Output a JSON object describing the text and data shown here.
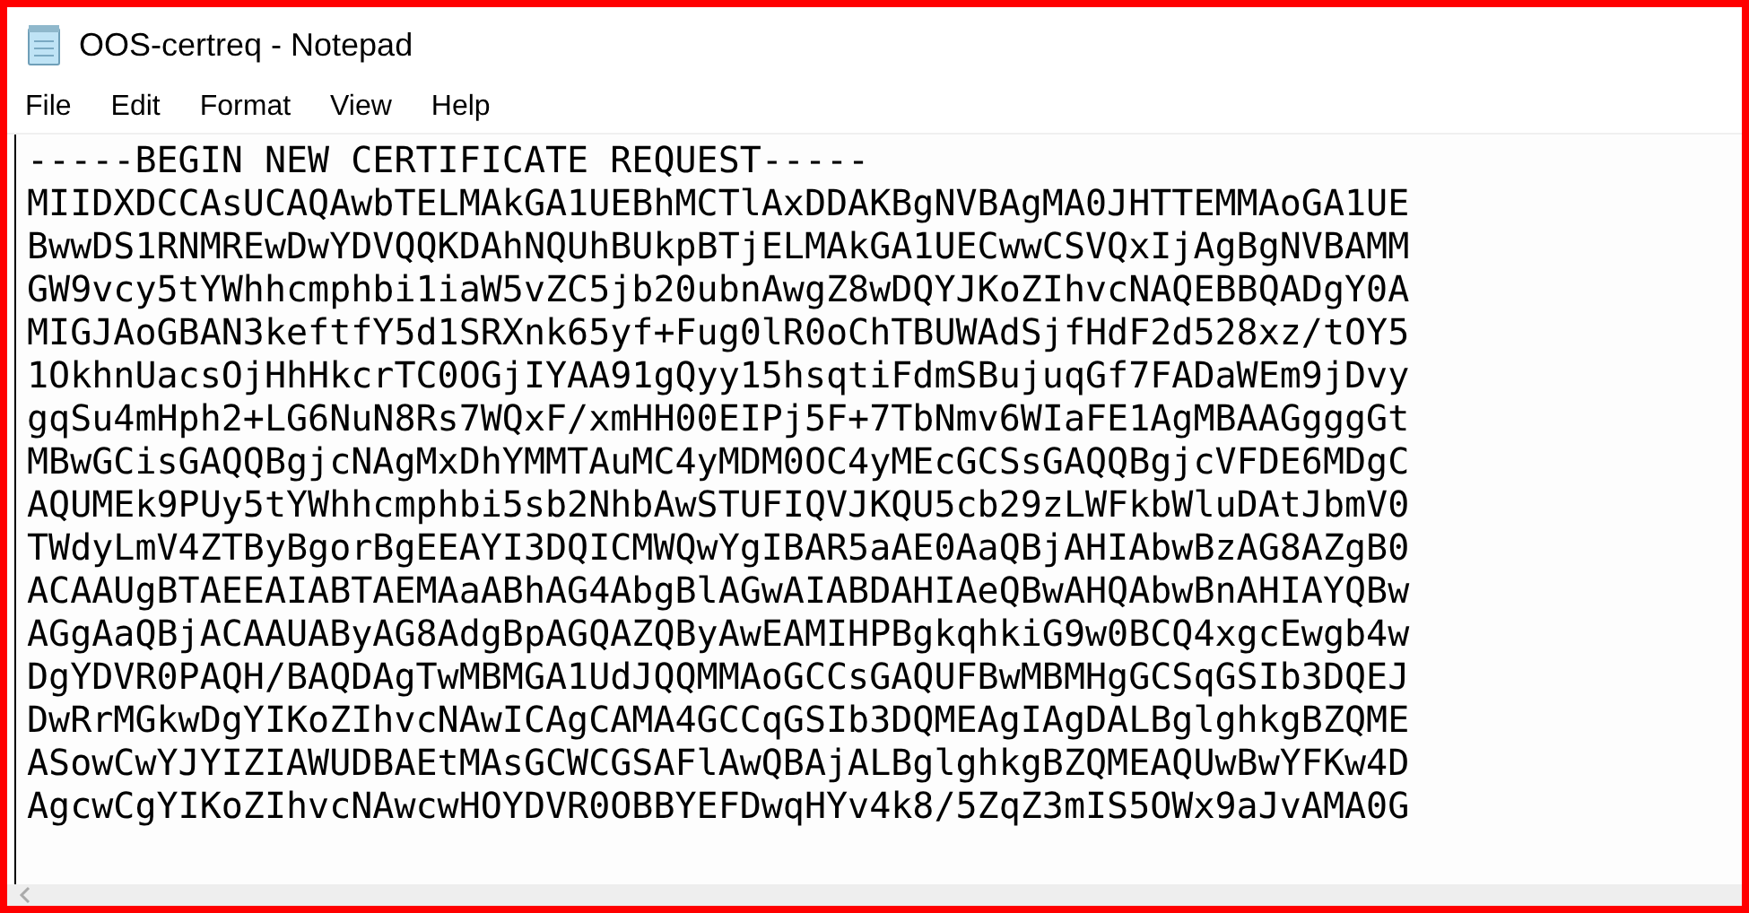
{
  "window": {
    "title": "OOS-certreq - Notepad"
  },
  "menu": [
    "File",
    "Edit",
    "Format",
    "View",
    "Help"
  ],
  "document": {
    "lines": [
      "-----BEGIN NEW CERTIFICATE REQUEST-----",
      "MIIDXDCCAsUCAQAwbTELMAkGA1UEBhMCTlAxDDAKBgNVBAgMA0JHTTEMMAoGA1UE",
      "BwwDS1RNMREwDwYDVQQKDAhNQUhBUkpBTjELMAkGA1UECwwCSVQxIjAgBgNVBAMM",
      "GW9vcy5tYWhhcmphbi1iaW5vZC5jb20ubnAwgZ8wDQYJKoZIhvcNAQEBBQADgY0A",
      "MIGJAoGBAN3keftfY5d1SRXnk65yf+Fug0lR0oChTBUWAdSjfHdF2d528xz/tOY5",
      "1OkhnUacsOjHhHkcrTC0OGjIYAA91gQyy15hsqtiFdmSBujuqGf7FADaWEm9jDvy",
      "gqSu4mHph2+LG6NuN8Rs7WQxF/xmHH00EIPj5F+7TbNmv6WIaFE1AgMBAAGgggGt",
      "MBwGCisGAQQBgjcNAgMxDhYMMTAuMC4yMDM0OC4yMEcGCSsGAQQBgjcVFDE6MDgC",
      "AQUMEk9PUy5tYWhhcmphbi5sb2NhbAwSTUFIQVJKQU5cb29zLWFkbWluDAtJbmV0",
      "TWdyLmV4ZTByBgorBgEEAYI3DQICMWQwYgIBAR5aAE0AaQBjAHIAbwBzAG8AZgB0",
      "ACAAUgBTAEEAIABTAEMAaABhAG4AbgBlAGwAIABDAHIAeQBwAHQAbwBnAHIAYQBw",
      "AGgAaQBjACAAUAByAG8AdgBpAGQAZQByAwEAMIHPBgkqhkiG9w0BCQ4xgcEwgb4w",
      "DgYDVR0PAQH/BAQDAgTwMBMGA1UdJQQMMAoGCCsGAQUFBwMBMHgGCSqGSIb3DQEJ",
      "DwRrMGkwDgYIKoZIhvcNAwICAgCAMA4GCCqGSIb3DQMEAgIAgDALBglghkgBZQME",
      "ASowCwYJYIZIAWUDBAEtMAsGCWCGSAFlAwQBAjALBglghkgBZQMEAQUwBwYFKw4D",
      "AgcwCgYIKoZIhvcNAwcwHOYDVR0OBBYEFDwqHYv4k8/5ZqZ3mIS5OWx9aJvAMA0G"
    ]
  }
}
